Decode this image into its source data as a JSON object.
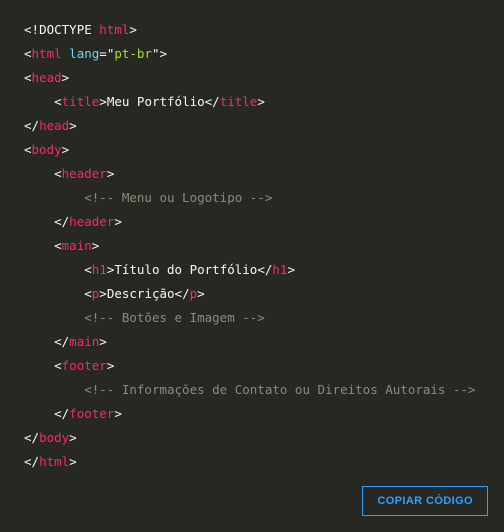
{
  "copy_button_label": "COPIAR CÓDIGO",
  "code": {
    "doctype_open": "<!",
    "doctype_word": "DOCTYPE ",
    "doctype_html": "html",
    "doctype_close": ">",
    "lt": "<",
    "lts": "</",
    "gt": ">",
    "eq": "=",
    "q": "\"",
    "tag_html": "html",
    "tag_head": "head",
    "tag_title": "title",
    "tag_body": "body",
    "tag_header": "header",
    "tag_main": "main",
    "tag_h1": "h1",
    "tag_p": "p",
    "tag_footer": "footer",
    "attr_lang": "lang",
    "val_lang": "pt-br",
    "text_title": "Meu Portfólio",
    "text_h1": "Título do Portfólio",
    "text_p": "Descrição",
    "comment_header": "<!-- Menu ou Logotipo -->",
    "comment_main": "<!-- Botões e Imagem -->",
    "comment_footer": "<!-- Informações de Contato ou Direitos Autorais -->",
    "pad1": "    ",
    "pad2": "        ",
    "pad3": "            "
  }
}
